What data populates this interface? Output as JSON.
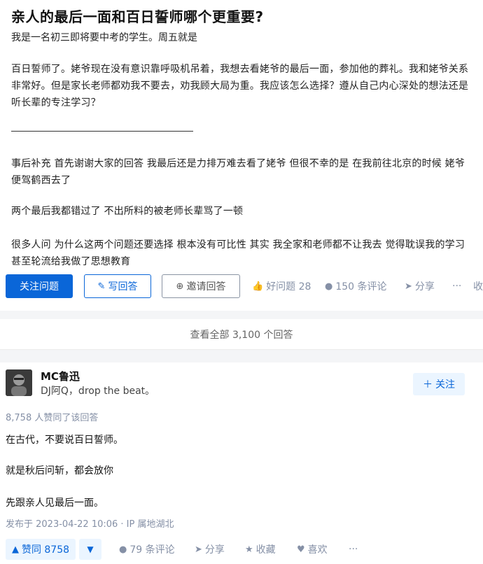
{
  "question": {
    "title": "亲人的最后一面和百日誓师哪个更重要?",
    "intro": "我是一名初三即将要中考的学生。周五就是",
    "body_1": "百日誓师了。姥爷现在没有意识靠呼吸机吊着，我想去看姥爷的最后一面，参加他的葬礼。我和姥爷关系非常好。但是家长老师都劝我不要去，劝我顾大局为重。我应该怎么选择？遵从自己内心深处的想法还是听长辈的专注学习？",
    "body_2": "事后补充 首先谢谢大家的回答 我最后还是力排万难去看了姥爷 但很不幸的是 在我前往北京的时候 姥爷便驾鹤西去了",
    "body_3": "两个最后我都错过了 不出所料的被老师长辈骂了一顿",
    "body_4": "很多人问 为什么这两个问题还要选择 根本没有可比性 其实 我全家和老师都不让我去 觉得耽误我的学习 甚至轮流给我做了思想教育"
  },
  "actions": {
    "follow_label": "关注问题",
    "write_label": "写回答",
    "invite_label": "邀请回答",
    "good_question_label": "好问题 28",
    "comments_label": "150 条评论",
    "share_label": "分享",
    "more_label": "···",
    "collapse_label": "收"
  },
  "view_all_label": "查看全部 3,100 个回答",
  "answer": {
    "author_name": "MC鲁迅",
    "author_bio": "DJ阿Q，drop the beat。",
    "follow_label": "关注",
    "vote_count": "8,758 人赞同了该回答",
    "line_1": "在古代，不要说百日誓师。",
    "line_2": "就是秋后问斩，都会放你",
    "line_3": "先跟亲人见最后一面。",
    "published": "发布于 2023-04-22 10:06 · IP 属地湖北"
  },
  "bottom": {
    "upvote_label": "赞同 8758",
    "downvote_label": "▼",
    "comments_label": "79 条评论",
    "share_label": "分享",
    "favorite_label": "收藏",
    "like_label": "喜欢",
    "more_label": "···"
  },
  "colors": {
    "brand_blue": "#0a66d8",
    "light_blue_bg": "#ebf5ff",
    "meta_gray": "#8590a6"
  }
}
